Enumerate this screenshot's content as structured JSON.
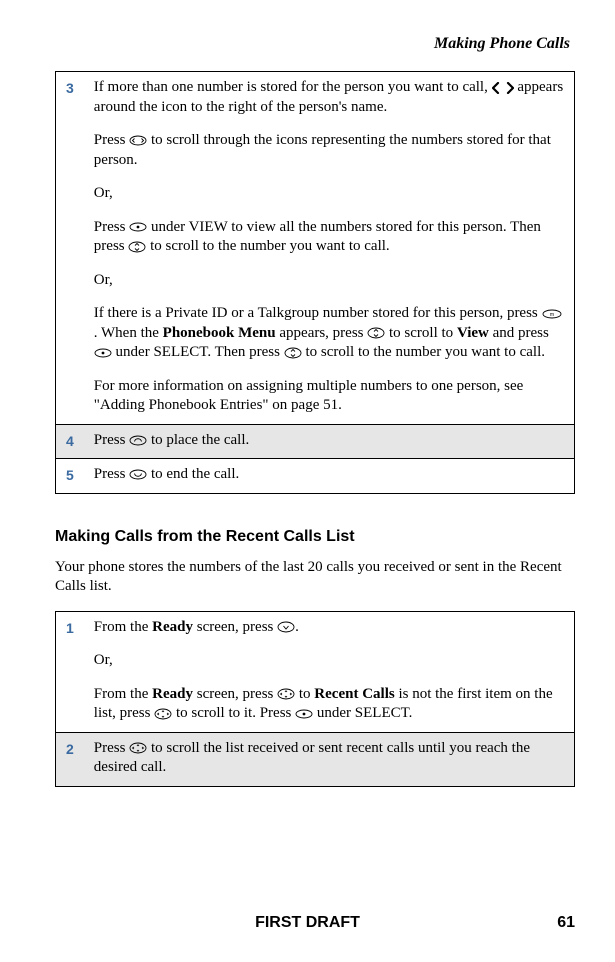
{
  "header": "Making Phone Calls",
  "table1": {
    "rows": [
      {
        "num": "3",
        "para1a": "If more than one number is stored for the person you want to call, ",
        "para1b": " appears around the icon to the right of the person's name.",
        "para2a": "Press ",
        "para2b": " to scroll through the icons representing the numbers stored for that person.",
        "or": "Or,",
        "para3a": "Press ",
        "para3b": " under VIEW to view all the numbers stored for this person. Then press ",
        "para3c": " to scroll to the number you want to call.",
        "para4a": "If there is a Private ID or a Talkgroup number stored for this person, press ",
        "para4b": ". When the ",
        "pbmenu": "Phonebook Menu",
        "para4c": " appears, press ",
        "para4d": " to scroll to ",
        "view": "View",
        "para4e": " and press ",
        "para4f": " under SELECT. Then press ",
        "para4g": " to scroll to the number you want to call.",
        "para5": "For more information on assigning multiple numbers to one person, see \"Adding Phonebook Entries\" on page 51."
      },
      {
        "num": "4",
        "text_a": "Press ",
        "text_b": " to place the call."
      },
      {
        "num": "5",
        "text_a": "Press ",
        "text_b": " to end the call."
      }
    ]
  },
  "subheading": "Making Calls from the Recent Calls List",
  "intro": "Your phone stores the numbers of the last 20 calls you received or sent in the Recent Calls list.",
  "table2": {
    "rows": [
      {
        "num": "1",
        "p1a": "From the ",
        "ready": "Ready",
        "p1b": " screen, press ",
        "p1c": ".",
        "or": "Or,",
        "p2a": "From the ",
        "p2b": " screen, press ",
        "p2c": " to ",
        "recent": "Recent Calls",
        "p2d": " is not the first item on the list, press ",
        "p2e": " to scroll to it. Press ",
        "p2f": " under SELECT."
      },
      {
        "num": "2",
        "text_a": "Press ",
        "text_b": " to scroll the list received or sent recent calls until you reach the desired call."
      }
    ]
  },
  "footer": "FIRST DRAFT",
  "pagenum": "61"
}
